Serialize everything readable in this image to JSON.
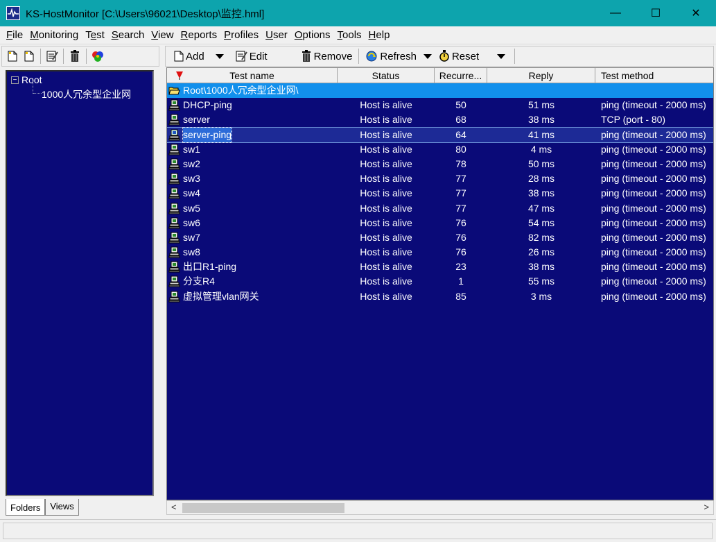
{
  "window": {
    "title": "KS-HostMonitor  [C:\\Users\\96021\\Desktop\\监控.hml]",
    "minimize_glyph": "—",
    "maximize_glyph": "☐",
    "close_glyph": "✕"
  },
  "menu": [
    {
      "pre": "",
      "key": "F",
      "post": "ile"
    },
    {
      "pre": "",
      "key": "M",
      "post": "onitoring"
    },
    {
      "pre": "T",
      "key": "e",
      "post": "st"
    },
    {
      "pre": "",
      "key": "S",
      "post": "earch"
    },
    {
      "pre": "",
      "key": "V",
      "post": "iew"
    },
    {
      "pre": "",
      "key": "R",
      "post": "eports"
    },
    {
      "pre": "",
      "key": "P",
      "post": "rofiles"
    },
    {
      "pre": "",
      "key": "U",
      "post": "ser"
    },
    {
      "pre": "",
      "key": "O",
      "post": "ptions"
    },
    {
      "pre": "",
      "key": "T",
      "post": "ools"
    },
    {
      "pre": "",
      "key": "H",
      "post": "elp"
    }
  ],
  "toolbar": {
    "add": "Add",
    "edit": "Edit",
    "remove": "Remove",
    "refresh": "Refresh",
    "reset": "Reset"
  },
  "tree": {
    "root": "Root",
    "expander": "−",
    "child": "1000人冗余型企业网"
  },
  "tabs": {
    "folders": "Folders",
    "views": "Views"
  },
  "columns": {
    "name": "Test name",
    "status": "Status",
    "recur": "Recurre...",
    "reply": "Reply",
    "method": "Test method"
  },
  "folder_row": "Root\\1000人冗余型企业网\\",
  "rows": [
    {
      "name": "DHCP-ping",
      "status": "Host is alive",
      "recur": "50",
      "reply": "51 ms",
      "method": "ping (timeout - 2000 ms)"
    },
    {
      "name": "server",
      "status": "Host is alive",
      "recur": "68",
      "reply": "38 ms",
      "method": "TCP (port - 80)"
    },
    {
      "name": "server-ping",
      "status": "Host is alive",
      "recur": "64",
      "reply": "41 ms",
      "method": "ping (timeout - 2000 ms)"
    },
    {
      "name": "sw1",
      "status": "Host is alive",
      "recur": "80",
      "reply": "4 ms",
      "method": "ping (timeout - 2000 ms)"
    },
    {
      "name": "sw2",
      "status": "Host is alive",
      "recur": "78",
      "reply": "50 ms",
      "method": "ping (timeout - 2000 ms)"
    },
    {
      "name": "sw3",
      "status": "Host is alive",
      "recur": "77",
      "reply": "28 ms",
      "method": "ping (timeout - 2000 ms)"
    },
    {
      "name": "sw4",
      "status": "Host is alive",
      "recur": "77",
      "reply": "38 ms",
      "method": "ping (timeout - 2000 ms)"
    },
    {
      "name": "sw5",
      "status": "Host is alive",
      "recur": "77",
      "reply": "47 ms",
      "method": "ping (timeout - 2000 ms)"
    },
    {
      "name": "sw6",
      "status": "Host is alive",
      "recur": "76",
      "reply": "54 ms",
      "method": "ping (timeout - 2000 ms)"
    },
    {
      "name": "sw7",
      "status": "Host is alive",
      "recur": "76",
      "reply": "82 ms",
      "method": "ping (timeout - 2000 ms)"
    },
    {
      "name": "sw8",
      "status": "Host is alive",
      "recur": "76",
      "reply": "26 ms",
      "method": "ping (timeout - 2000 ms)"
    },
    {
      "name": "出口R1-ping",
      "status": "Host is alive",
      "recur": "23",
      "reply": "38 ms",
      "method": "ping (timeout - 2000 ms)"
    },
    {
      "name": "分支R4",
      "status": "Host is alive",
      "recur": "1",
      "reply": "55 ms",
      "method": "ping (timeout - 2000 ms)"
    },
    {
      "name": "虚拟管理vlan网关",
      "status": "Host is alive",
      "recur": "85",
      "reply": "3 ms",
      "method": "ping (timeout - 2000 ms)"
    }
  ],
  "selected_row": "server-ping",
  "colors": {
    "title_bar": "#0da4ad",
    "list_bg": "#0a0a78",
    "folder_row": "#1290ec",
    "text": "#ffffff"
  },
  "scrollbar": {
    "left_glyph": "<",
    "right_glyph": ">"
  }
}
